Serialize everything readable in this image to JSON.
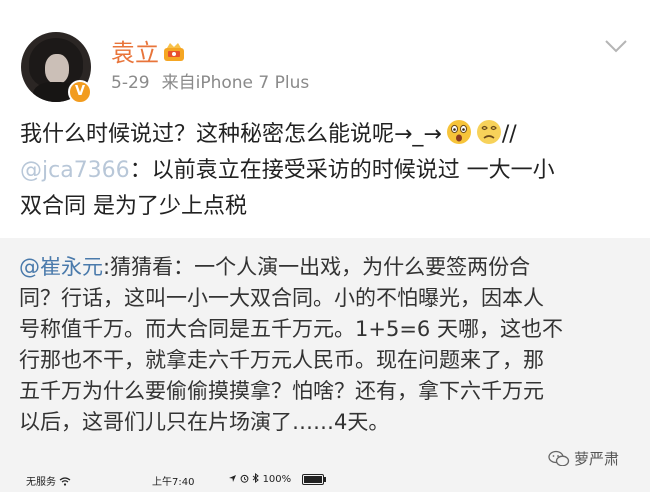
{
  "post": {
    "username": "袁立",
    "date": "5-29",
    "source": "来自iPhone 7 Plus",
    "verified_badge": "V",
    "vip_icon": "vip-crown-icon",
    "repost_line1": "我什么时候说过？这种秘密怎么能说呢→_→",
    "repost_slashes": "//",
    "repost_mention": "@jca7366",
    "repost_line2_rest": "：以前袁立在接受采访的时候说过 一大一小",
    "repost_line3": "双合同 是为了少上点税"
  },
  "original": {
    "mention": "@崔永元",
    "line1_rest": ":猜猜看：一个人演一出戏，为什么要签两份合",
    "line2": "同？行话，这叫一小一大双合同。小的不怕曝光，因本人",
    "line3": "号称值千万。而大合同是五千万元。1+5=6 天哪，这也不",
    "line4": "行那也不干，就拿走六千万元人民币。现在问题来了，那",
    "line5": "五千万为什么要偷偷摸摸拿？怕啥？还有，拿下六千万元",
    "line6": "以后，这哥们儿只在片场演了……4天。"
  },
  "statusbar": {
    "carrier": "无服务",
    "time": "上午7:40",
    "battery": "100%"
  },
  "watermark": {
    "text": "萝严肃"
  },
  "colors": {
    "username": "#e8743a",
    "mention": "#4a7aab",
    "verified": "#f29c1f"
  }
}
